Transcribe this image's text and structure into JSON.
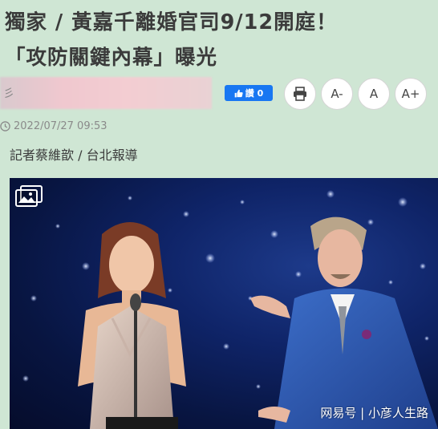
{
  "article": {
    "headline_line1": "獨家 / 黃嘉千離婚官司9/12開庭！",
    "headline_line2": "「攻防關鍵內幕」曝光",
    "blurred_prefix": "彡",
    "like_label": "讚 0",
    "print_icon": "print-icon",
    "font_decrease": "A-",
    "font_reset": "A",
    "font_increase": "A+",
    "timestamp": "2022/07/27 09:53",
    "byline": "記者蔡維歆 / 台北報導"
  },
  "photo": {
    "gallery_icon": "gallery-icon",
    "watermark": "网易号 | 小彦人生路"
  },
  "colors": {
    "page_bg": "#cfe6d4",
    "facebook_blue": "#1877f2",
    "stage_blue": "#0f2468"
  }
}
